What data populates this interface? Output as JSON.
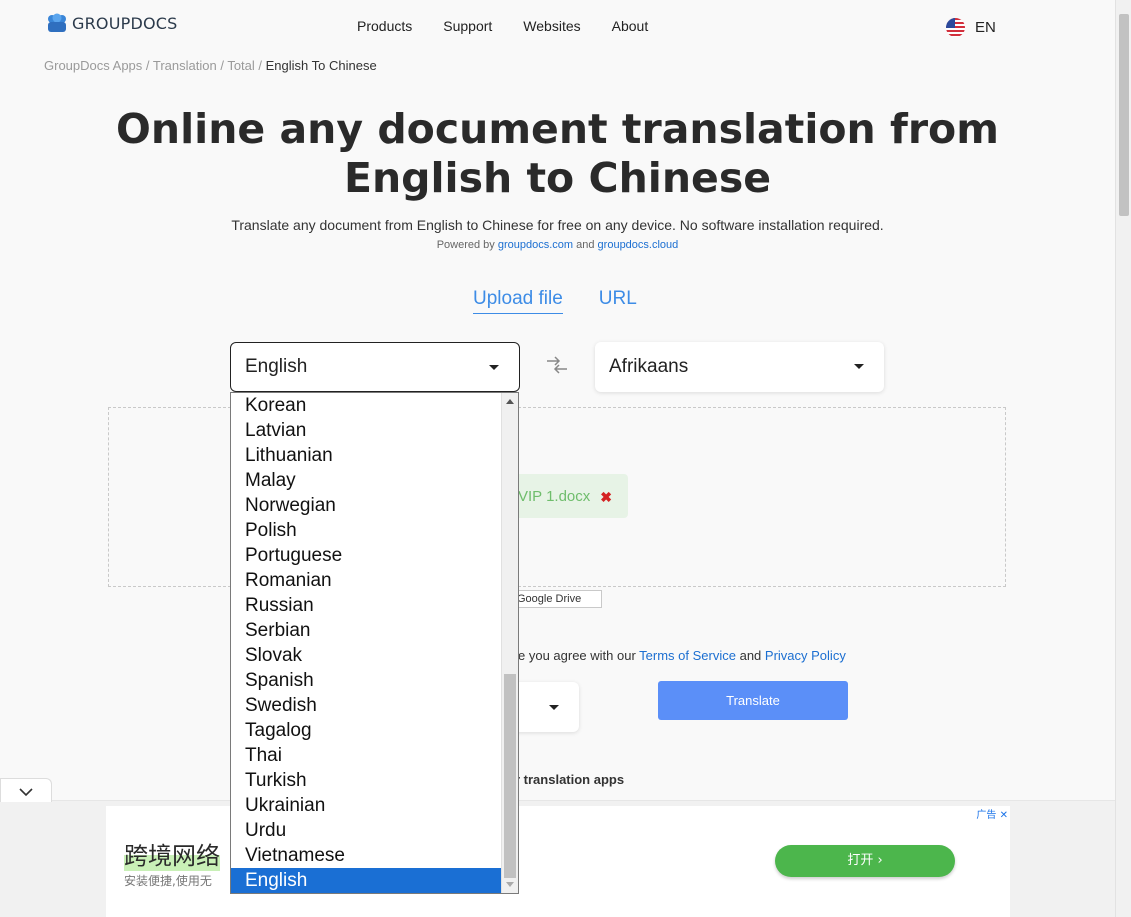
{
  "header": {
    "logo_text": "GROUPDOCS",
    "nav": [
      "Products",
      "Support",
      "Websites",
      "About"
    ],
    "lang": "EN"
  },
  "breadcrumb": {
    "items": [
      "GroupDocs Apps",
      "Translation",
      "Total"
    ],
    "current": "English To Chinese",
    "separator": " / "
  },
  "main": {
    "title": "Online any document translation from English to Chinese",
    "subtitle": "Translate any document from English to Chinese for free on any device. No software installation required.",
    "powered_prefix": "Powered by ",
    "powered_link1": "groupdocs.com",
    "powered_and": " and ",
    "powered_link2": "groupdocs.cloud",
    "tabs": [
      "Upload file",
      "URL"
    ],
    "source_language": "English",
    "target_language": "Afrikaans",
    "file_name": "VIP 1.docx",
    "google_drive": "Google Drive",
    "terms_prefix": "e you agree with our ",
    "terms_link": "Terms of Service",
    "terms_and": " and ",
    "privacy_link": "Privacy Policy",
    "translate_button": "Translate",
    "other_apps": "r translation apps"
  },
  "dropdown": {
    "options": [
      "Korean",
      "Latvian",
      "Lithuanian",
      "Malay",
      "Norwegian",
      "Polish",
      "Portuguese",
      "Romanian",
      "Russian",
      "Serbian",
      "Slovak",
      "Spanish",
      "Swedish",
      "Tagalog",
      "Thai",
      "Turkish",
      "Ukrainian",
      "Urdu",
      "Vietnamese",
      "English"
    ],
    "selected": "English"
  },
  "ad": {
    "headline": "跨境网络",
    "subline": "安装便捷,使用无",
    "button": "打开",
    "label": "广告"
  },
  "colors": {
    "accent": "#3d8ce6",
    "button": "#5b8ff8",
    "selected": "#1a6fd4",
    "ad_button": "#4cb64c"
  }
}
